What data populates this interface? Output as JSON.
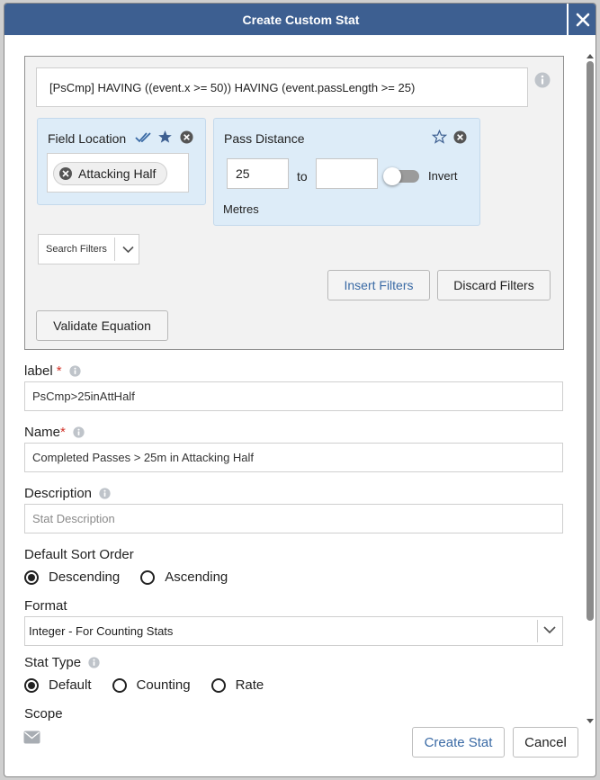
{
  "dialog": {
    "title": "Create Custom Stat"
  },
  "equation": {
    "text": "[PsCmp] HAVING ((event.x >= 50)) HAVING (event.passLength >= 25)"
  },
  "filters": {
    "field_location": {
      "title": "Field Location",
      "chip": "Attacking Half"
    },
    "pass_distance": {
      "title": "Pass Distance",
      "min_value": "25",
      "max_value": "",
      "to_label": "to",
      "invert_label": "Invert",
      "unit": "Metres"
    },
    "search_filters_placeholder": "Search Filters",
    "insert_label": "Insert Filters",
    "discard_label": "Discard Filters",
    "validate_label": "Validate Equation"
  },
  "form": {
    "label_field": {
      "label": "label",
      "required_mark": "*",
      "value": "PsCmp>25inAttHalf"
    },
    "name_field": {
      "label": "Name",
      "required_mark": "*",
      "value": "Completed Passes > 25m in Attacking Half"
    },
    "description_field": {
      "label": "Description",
      "placeholder": "Stat Description"
    },
    "sort_order": {
      "label": "Default Sort Order",
      "options": [
        "Descending",
        "Ascending"
      ],
      "selected": "Descending"
    },
    "format": {
      "label": "Format",
      "value": "Integer - For Counting Stats"
    },
    "stat_type": {
      "label": "Stat Type",
      "options": [
        "Default",
        "Counting",
        "Rate"
      ],
      "selected": "Default"
    },
    "scope": {
      "label": "Scope"
    }
  },
  "footer": {
    "create_label": "Create Stat",
    "cancel_label": "Cancel"
  },
  "colors": {
    "titlebar": "#3d5f91",
    "accent_blue": "#3a6aa5",
    "card_bg": "#ddecf8",
    "required": "#d2342a"
  }
}
